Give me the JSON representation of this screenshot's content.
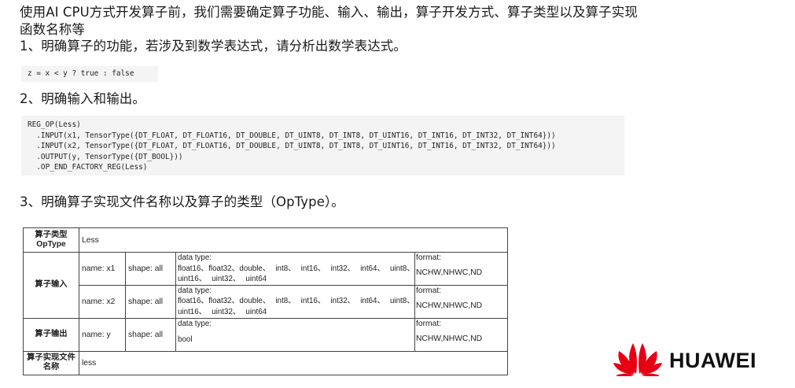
{
  "intro": {
    "line1": "使用AI CPU方式开发算子前，我们需要确定算子功能、输入、输出，算子开发方式、算子类型以及算子实现",
    "line2": "函数名称等"
  },
  "step1": {
    "heading": "1、明确算子的功能，若涉及到数学表达式，请分析出数学表达式。",
    "code": "z = x < y ? true : false"
  },
  "step2": {
    "heading": "2、明确输入和输出。",
    "code": "REG_OP(Less)\n  .INPUT(x1, TensorType({DT_FLOAT, DT_FLOAT16, DT_DOUBLE, DT_UINT8, DT_INT8, DT_UINT16, DT_INT16, DT_INT32, DT_INT64}))\n  .INPUT(x2, TensorType({DT_FLOAT, DT_FLOAT16, DT_DOUBLE, DT_UINT8, DT_INT8, DT_UINT16, DT_INT16, DT_INT32, DT_INT64}))\n  .OUTPUT(y, TensorType({DT_BOOL}))\n  .OP_END_FACTORY_REG(Less)"
  },
  "step3": {
    "heading": "3、明确算子实现文件名称以及算子的类型（OpType）。"
  },
  "table": {
    "optype_header": "算子类型\nOpType",
    "optype_value": "Less",
    "input_header": "算子输入",
    "output_header": "算子输出",
    "impl_header": "算子实现文件\n名称",
    "impl_value": "less",
    "data_type_label": "data type:",
    "format_label": "format:",
    "inputs": [
      {
        "name": "name: x1",
        "shape": "shape: all",
        "types": "float16、float32、double、 int8、 int16、 int32、 int64、 uint8、 uint16、 uint32、 uint64",
        "format": "NCHW,NHWC,ND"
      },
      {
        "name": "name: x2",
        "shape": "shape: all",
        "types": "float16、float32、double、 int8、 int16、 int32、 int64、 uint8、 uint16、 uint32、 uint64",
        "format": "NCHW,NHWC,ND"
      }
    ],
    "output": {
      "name": "name: y",
      "shape": "shape: all",
      "types": "bool",
      "format": "NCHW,NHWC,ND"
    }
  },
  "logo": {
    "text": "HUAWEI",
    "color": "#e60012",
    "icon": "huawei-petal-logo-icon"
  }
}
